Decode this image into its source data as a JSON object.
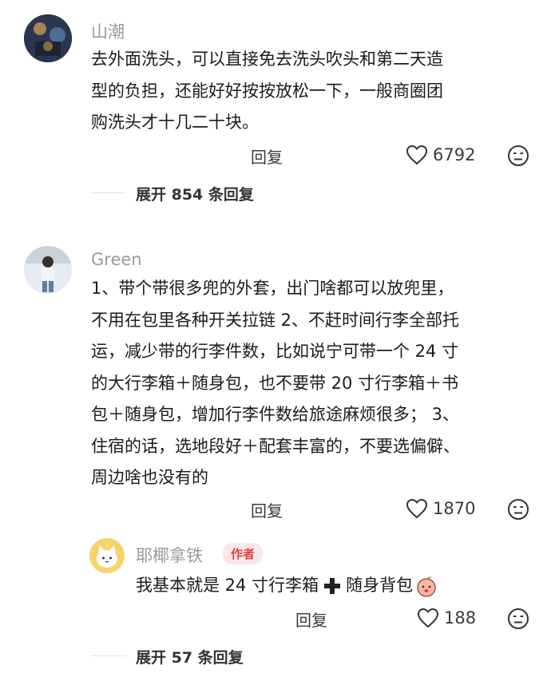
{
  "comments": [
    {
      "username": "山潮",
      "text_lines": [
        "去外面洗头，可以直接免去洗头吹头和第二天造",
        "型的负担，还能好好按按放松一下，一般商圈团",
        "购洗头才十几二十块。"
      ],
      "reply_label": "回复",
      "likes": "6792",
      "expand_label": "展开 854 条回复"
    },
    {
      "username": "Green",
      "text_lines": [
        "1、带个带很多兜的外套，出门啥都可以放兜里，",
        "不用在包里各种开关拉链 2、不赶时间行李全部托",
        "运，减少带的行李件数，比如说宁可带一个 24 寸",
        "的大行李箱＋随身包，也不要带 20 寸行李箱＋书",
        "包＋随身包，增加行李件数给旅途麻烦很多； 3、",
        "住宿的话，选地段好＋配套丰富的，不要选偏僻、",
        "周边啥也没有的"
      ],
      "reply_label": "回复",
      "likes": "1870",
      "reply": {
        "username": "耶椰拿铁",
        "badge": "作者",
        "text": "我基本就是 24 寸行李箱",
        "text_suffix": "随身背包",
        "reply_label": "回复",
        "likes": "188"
      },
      "expand_label": "展开 57 条回复"
    }
  ],
  "icons": {
    "like": "heart-outline-icon",
    "dislike": "frown-face-icon",
    "plus": "heavy-plus-icon",
    "emoji": "peach-face-emoji"
  }
}
